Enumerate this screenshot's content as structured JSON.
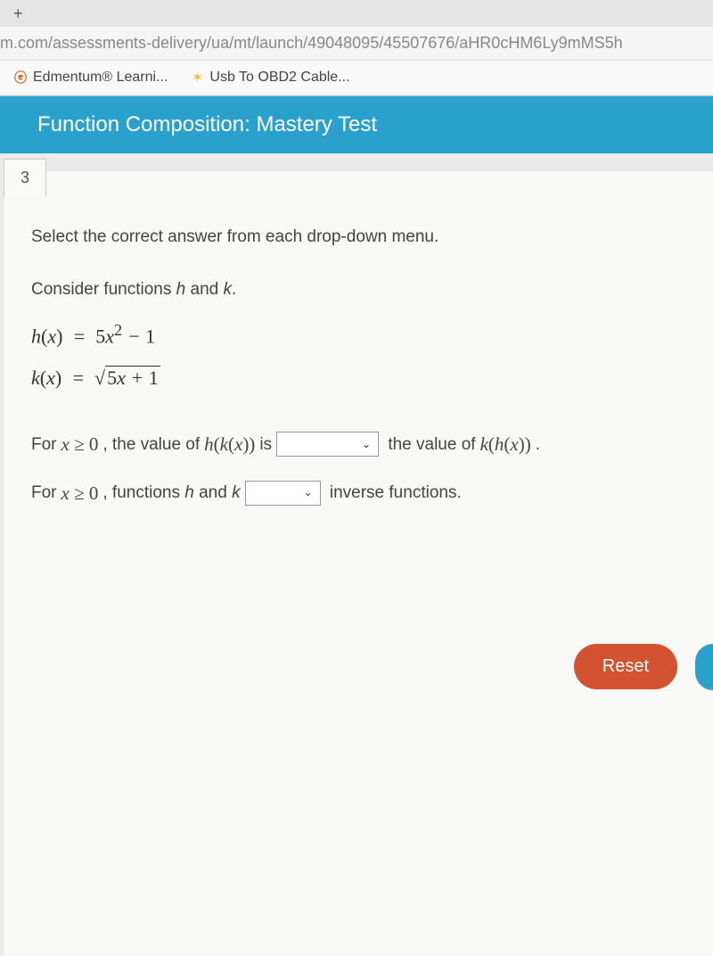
{
  "browser": {
    "url": "m.com/assessments-delivery/ua/mt/launch/49048095/45507676/aHR0cHM6Ly9mMS5h",
    "bookmarks": [
      {
        "icon": "edmentum",
        "label": "Edmentum® Learni..."
      },
      {
        "icon": "walmart",
        "label": "Usb To OBD2 Cable..."
      }
    ]
  },
  "header": {
    "title": "Function Composition: Mastery Test"
  },
  "question": {
    "number": "3",
    "instruction": "Select the correct answer from each drop-down menu.",
    "consider": "Consider functions h and k.",
    "eq1_lhs": "h(x)",
    "eq1_rhs": "5x² − 1",
    "eq2_lhs": "k(x)",
    "eq2_rhs": "√(5x + 1)",
    "line1_pre": "For ",
    "line1_cond": "x ≥ 0",
    "line1_mid1": ", the value of ",
    "line1_expr1": "h(k(x))",
    "line1_mid2": " is",
    "line1_mid3": "the value of ",
    "line1_expr2": "k(h(x))",
    "line1_end": ".",
    "line2_pre": "For ",
    "line2_cond": "x ≥ 0",
    "line2_mid1": ", functions h and k",
    "line2_end": "inverse functions."
  },
  "buttons": {
    "reset": "Reset"
  }
}
